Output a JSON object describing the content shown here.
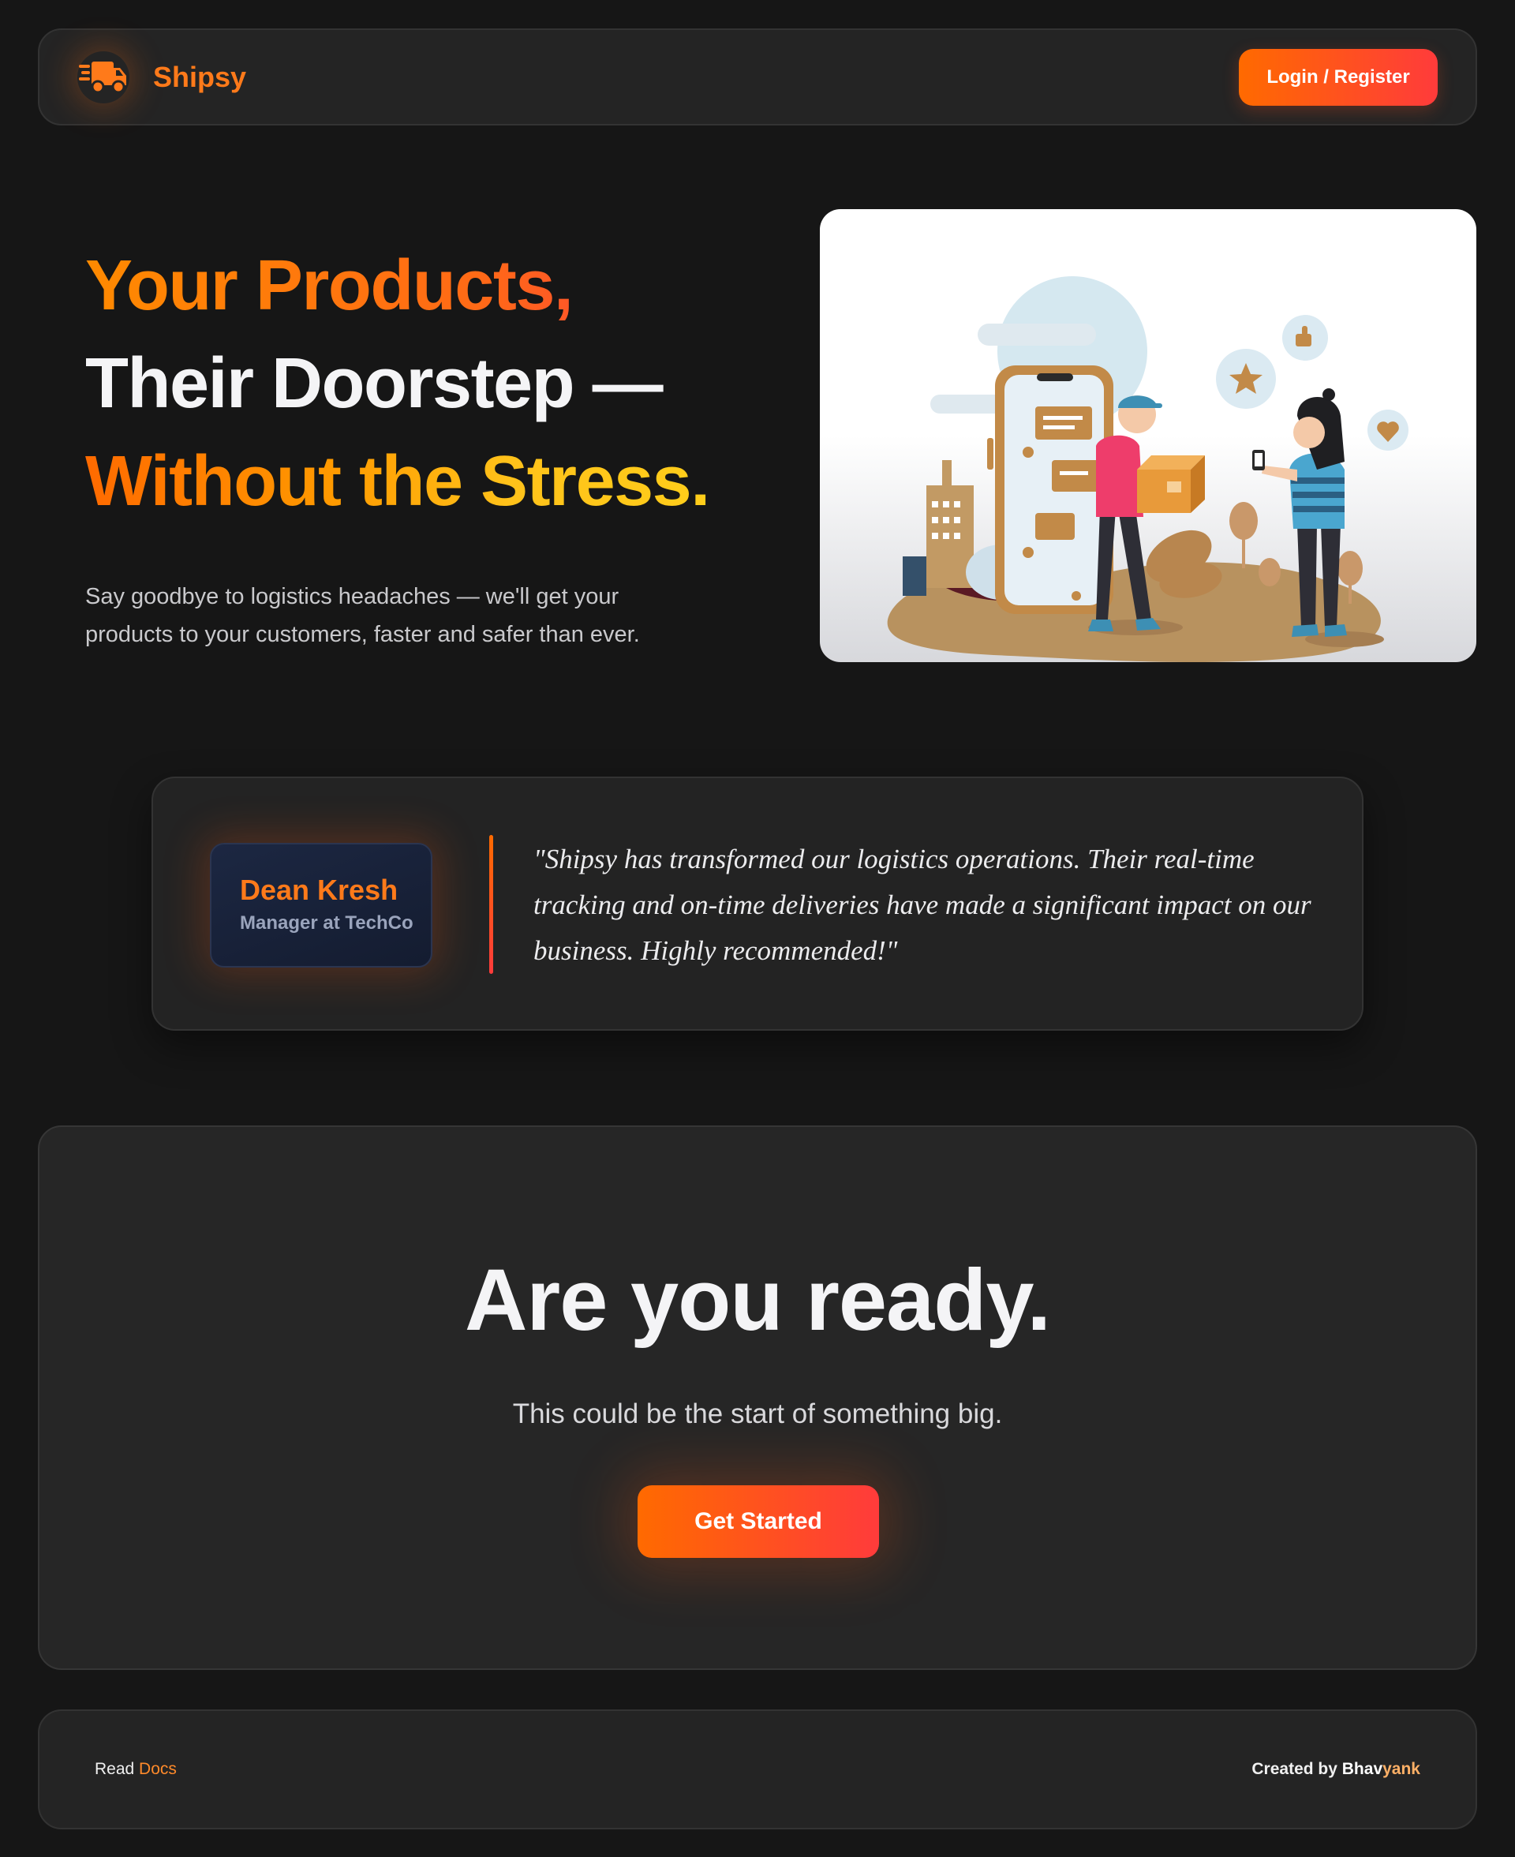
{
  "brand": {
    "name": "Shipsy",
    "logo_icon": "truck-icon",
    "accent": "#ff7a1a"
  },
  "nav": {
    "login_label": "Login / Register"
  },
  "hero": {
    "line1": "Your Products,",
    "line2": "Their Doorstep —",
    "line3": "Without the Stress.",
    "subtitle": "Say goodbye to logistics headaches — we'll get your products to your customers, faster and safer than ever.",
    "illustration": "delivery-illustration"
  },
  "testimonial": {
    "author_name": "Dean Kresh",
    "author_role": "Manager at TechCo",
    "quote": "\"Shipsy has transformed our logistics operations. Their real-time tracking and on-time deliveries have made a significant impact on our business. Highly recommended!\""
  },
  "cta": {
    "title": "Are you ready.",
    "subtitle": "This could be the start of something big.",
    "button_label": "Get Started"
  },
  "footer": {
    "read_prefix": "Read ",
    "docs_link": "Docs",
    "created_prefix": "Created by ",
    "creator_part1": "Bhav",
    "creator_part2": "yank"
  },
  "colors": {
    "background": "#161616",
    "card": "#242424",
    "gradient_start": "#ff6a00",
    "gradient_end": "#ff3b3b",
    "yellow": "#ffc21a"
  }
}
